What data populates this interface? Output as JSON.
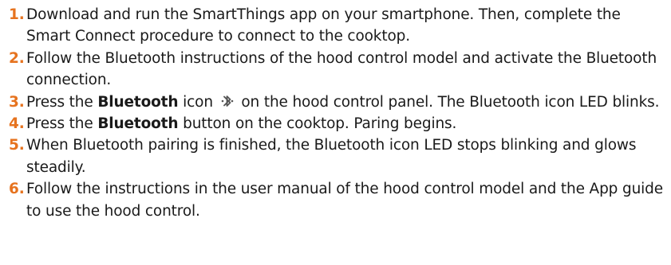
{
  "colors": {
    "step_number": "#e6731f",
    "text": "#1a1a1a"
  },
  "steps": [
    {
      "number": "1.",
      "text": "Download and run the SmartThings app on your smartphone. Then, complete the Smart Connect procedure to connect to the cooktop."
    },
    {
      "number": "2.",
      "text": "Follow the Bluetooth instructions of the hood control model and activate the Bluetooth connection."
    },
    {
      "number": "3.",
      "pre": "Press the ",
      "bold": "Bluetooth",
      "mid": " icon",
      "icon": "bluetooth-icon",
      "post": " on the hood control panel. The Bluetooth icon LED blinks."
    },
    {
      "number": "4.",
      "pre": "Press the ",
      "bold": "Bluetooth",
      "post": " button on the cooktop. Paring begins."
    },
    {
      "number": "5.",
      "text": "When Bluetooth pairing is finished, the Bluetooth icon LED stops blinking and glows steadily."
    },
    {
      "number": "6.",
      "text": "Follow the instructions in the user manual of the hood control model and the App guide to use the hood control."
    }
  ]
}
